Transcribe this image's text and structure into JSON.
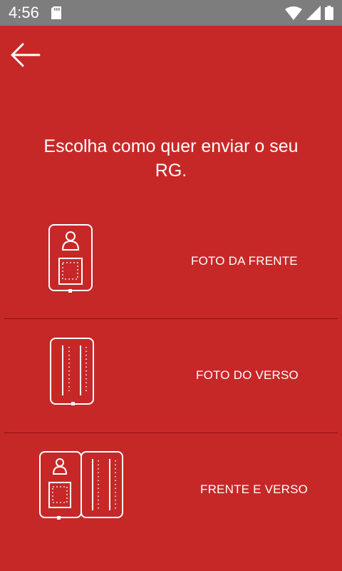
{
  "status_bar": {
    "time": "4:56",
    "icons": [
      "sd-card-icon",
      "wifi-icon",
      "signal-icon",
      "battery-icon"
    ]
  },
  "header": {
    "back_icon": "arrow-left-icon"
  },
  "main": {
    "title": "Escolha como quer enviar o seu RG.",
    "options": [
      {
        "label": "FOTO DA FRENTE",
        "icon": "id-front-icon"
      },
      {
        "label": "FOTO DO VERSO",
        "icon": "id-back-icon"
      },
      {
        "label": "FRENTE E VERSO",
        "icon": "id-front-back-icon"
      }
    ]
  },
  "colors": {
    "background": "#c62828",
    "status_bar": "#7d7d7d",
    "divider": "#8e1010",
    "foreground": "#ffffff"
  }
}
